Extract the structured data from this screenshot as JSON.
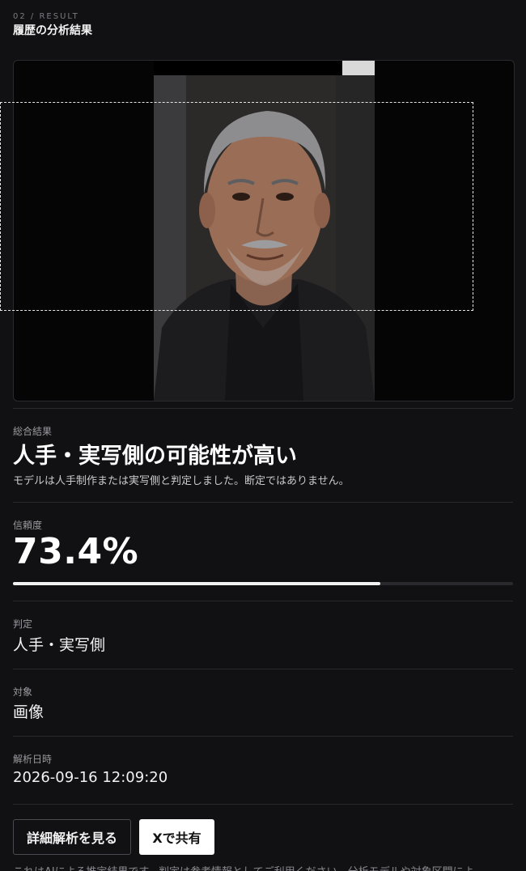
{
  "header": {
    "eyebrow": "02 / RESULT",
    "title": "履歴の分析結果"
  },
  "overall": {
    "label": "総合結果",
    "headline": "人手・実写側の可能性が高い",
    "description": "モデルは人手制作または実写側と判定しました。断定ではありません。"
  },
  "confidence": {
    "label": "信頼度",
    "value_text": "73.4%",
    "fraction": 0.734
  },
  "verdict": {
    "label": "判定",
    "value": "人手・実写側"
  },
  "target": {
    "label": "対象",
    "value": "画像"
  },
  "analyzed_at": {
    "label": "解析日時",
    "value": "2026-09-16 12:09:20"
  },
  "actions": {
    "details_label": "詳細解析を見る",
    "share_label": "Xで共有"
  },
  "footnote": "これはAIによる推定結果です。判定は参考情報としてご利用ください。分析モデルや対象区間によ",
  "colors": {
    "background": "#111113",
    "bar_fill": "#f2f2f2",
    "bar_track": "#2a2a2e"
  }
}
